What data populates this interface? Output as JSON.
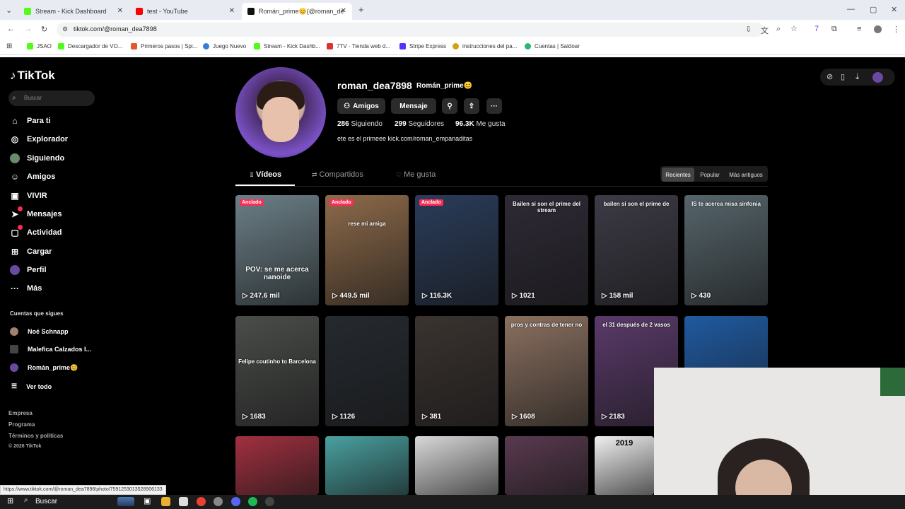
{
  "browser": {
    "tabs": [
      {
        "title": "Stream - Kick Dashboard",
        "color": "#53fc18"
      },
      {
        "title": "test - YouTube",
        "color": "#ff0000"
      },
      {
        "title": "Román_prime😊(@roman_de...",
        "color": "#111111"
      }
    ],
    "add_tab": "+",
    "url": "tiktok.com/@roman_dea7898",
    "bookmarks": [
      "JSAO",
      "Descargador de VO...",
      "Primeros pasos | Spi...",
      "Juego Nuevo",
      "Stream - Kick Dashb...",
      "7TV · Tienda web d...",
      "Stripe Express",
      "instrucciones del pa...",
      "Cuentas | Saldoar"
    ],
    "status_url": "https://www.tiktok.com/@roman_dea7898/photo/7591253013528906133"
  },
  "tiktok": {
    "logo": "TikTok",
    "search_placeholder": "Buscar",
    "nav": [
      {
        "label": "Para ti",
        "icon": "⌂"
      },
      {
        "label": "Explorador",
        "icon": "◎"
      },
      {
        "label": "Siguiendo",
        "icon": "●"
      },
      {
        "label": "Amigos",
        "icon": "☺"
      },
      {
        "label": "VIVIR",
        "icon": "▣"
      },
      {
        "label": "Mensajes",
        "icon": "➤"
      },
      {
        "label": "Actividad",
        "icon": "▢"
      },
      {
        "label": "Cargar",
        "icon": "⊞"
      },
      {
        "label": "Perfil",
        "icon": "●"
      },
      {
        "label": "Más",
        "icon": "···"
      }
    ],
    "following_title": "Cuentas que sigues",
    "following": [
      "Noé Schnapp",
      "Malefica Calzados I...",
      "Román_prime😊"
    ],
    "see_all": "Ver todo",
    "footer": [
      "Empresa",
      "Programa",
      "Términos y políticas",
      "© 2026 TikTok"
    ]
  },
  "profile": {
    "username": "roman_dea7898",
    "nickname": "Román_prime😊",
    "buttons": {
      "friends": "Amigos",
      "message": "Mensaje"
    },
    "stats": [
      {
        "value": "286",
        "label": "Siguiendo"
      },
      {
        "value": "299",
        "label": "Seguidores"
      },
      {
        "value": "96.3K",
        "label": "Me gusta"
      }
    ],
    "bio": "ete es el primeee kick.com/roman_empanaditas",
    "tabs": [
      "Vídeos",
      "Compartidos",
      "Me gusta"
    ],
    "sort": [
      "Recientes",
      "Popular",
      "Más antiguos"
    ]
  },
  "videos": [
    {
      "views": "247.6 mil",
      "pinned": "Anclado",
      "caption": "POV: se me acerca nanoide",
      "color": "#6b7f87"
    },
    {
      "views": "449.5 mil",
      "pinned": "Anclado",
      "caption": "rese mi amiga",
      "color": "#8d6a4a"
    },
    {
      "views": "116.3K",
      "pinned": "Anclado",
      "caption": "",
      "color": "#2a3c5a"
    },
    {
      "views": "1021",
      "pinned": "",
      "caption": "Bailen si son el prime del stream",
      "color": "#2e2a36"
    },
    {
      "views": "158 mil",
      "pinned": "",
      "caption": "bailen si son el prime de",
      "color": "#3c3b46"
    },
    {
      "views": "430",
      "pinned": "",
      "caption": "IS te acerca misa sinfonia",
      "color": "#56656b"
    },
    {
      "views": "1683",
      "pinned": "",
      "caption": "Felipe coutinho to Barcelona",
      "color": "#4a4d4a"
    },
    {
      "views": "1126",
      "pinned": "",
      "caption": "",
      "color": "#252a30"
    },
    {
      "views": "381",
      "pinned": "",
      "caption": "",
      "color": "#3a3330"
    },
    {
      "views": "1608",
      "pinned": "",
      "caption": "pros y contras de tener no",
      "color": "#8a7060"
    },
    {
      "views": "2183",
      "pinned": "",
      "caption": "el 31 después de 2 vasos",
      "color": "#5a3a6a"
    },
    {
      "views": "",
      "pinned": "",
      "caption": "",
      "color": "#1f5aa0"
    },
    {
      "views": "",
      "pinned": "",
      "caption": "",
      "color": "#a23040"
    },
    {
      "views": "",
      "pinned": "",
      "caption": "",
      "color": "#4aa0a0"
    },
    {
      "views": "",
      "pinned": "",
      "caption": "",
      "color": "#d8d8d8"
    },
    {
      "views": "",
      "pinned": "",
      "caption": "",
      "color": "#5a3a50"
    },
    {
      "views": "",
      "pinned": "",
      "caption": "2019",
      "color": "#f0f0f0"
    }
  ],
  "taskbar": {
    "search": "Buscar"
  }
}
